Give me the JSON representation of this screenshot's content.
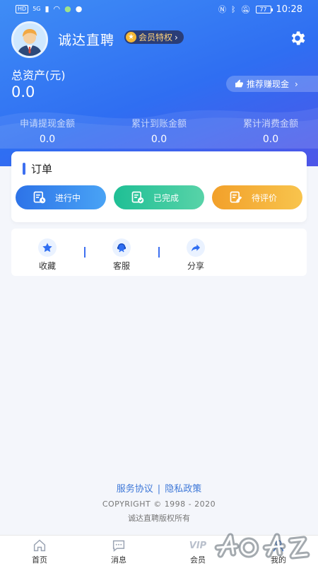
{
  "status_bar": {
    "left_badge": "HD",
    "network": "5G",
    "battery": "77",
    "time": "10:28"
  },
  "profile": {
    "username": "诚达直聘",
    "vip_label": "会员特权",
    "settings_icon": "gear-icon"
  },
  "assets": {
    "label": "总资产(元)",
    "value": "0.0",
    "recommend_label": "推荐赚现金"
  },
  "stats": [
    {
      "label": "申请提现金额",
      "value": "0.0"
    },
    {
      "label": "累计到账金额",
      "value": "0.0"
    },
    {
      "label": "累计消费金额",
      "value": "0.0"
    }
  ],
  "orders": {
    "title": "订单",
    "buttons": [
      {
        "label": "进行中",
        "icon": "list-clock-icon",
        "color": "#2d73e8"
      },
      {
        "label": "已完成",
        "icon": "list-check-icon",
        "color": "#1fbf95"
      },
      {
        "label": "待评价",
        "icon": "edit-note-icon",
        "color": "#f2a02a"
      }
    ]
  },
  "tools": [
    {
      "label": "收藏",
      "icon": "star-icon"
    },
    {
      "label": "客服",
      "icon": "customer-service-icon"
    },
    {
      "label": "分享",
      "icon": "share-icon"
    }
  ],
  "footer": {
    "service_agreement": "服务协议",
    "privacy_policy": "隐私政策",
    "separator": "|",
    "copyright": "COPYRIGHT © 1998 - 2020",
    "rights": "诚达直聘版权所有"
  },
  "tabbar": [
    {
      "label": "首页",
      "icon": "home-icon"
    },
    {
      "label": "消息",
      "icon": "message-icon"
    },
    {
      "label": "会员",
      "icon": "vip-icon",
      "icon_text": "VIP"
    },
    {
      "label": "我的",
      "icon": "user-icon"
    }
  ],
  "colors": {
    "primary": "#2f6ef2",
    "link": "#3e78d8"
  }
}
